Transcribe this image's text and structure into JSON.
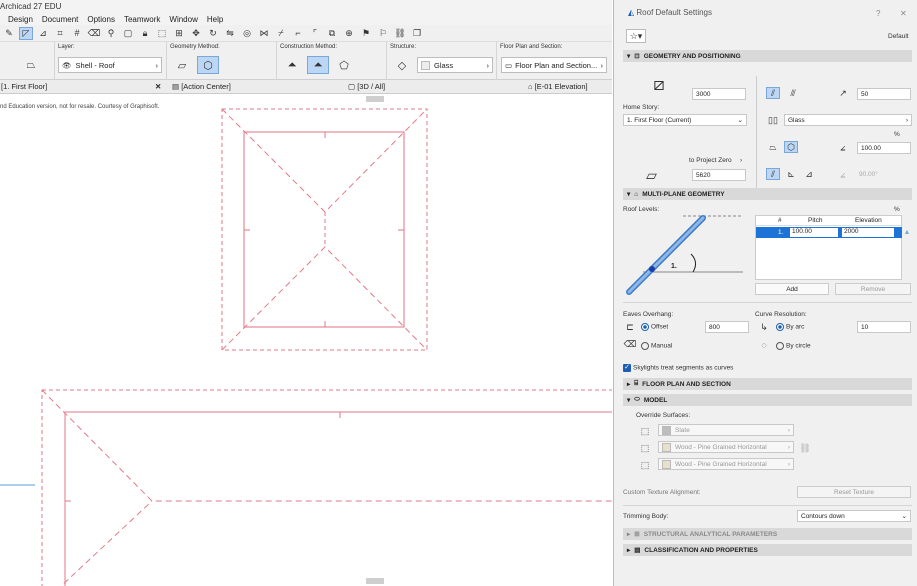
{
  "app": {
    "title": "Archicad 27 EDU",
    "menu": [
      "Design",
      "Document",
      "Options",
      "Teamwork",
      "Window",
      "Help"
    ]
  },
  "infobox": {
    "layer_label": "Layer:",
    "layer_value": "Shell - Roof",
    "geometry_label": "Geometry Method:",
    "construction_label": "Construction Method:",
    "structure_label": "Structure:",
    "structure_value": "Glass",
    "floorplan_label": "Floor Plan and Section:",
    "floorplan_value": "Floor Plan and Section..."
  },
  "tabs": [
    "[1. First Floor]",
    "[Action Center]",
    "[3D / All]",
    "[E-01 Elevation]"
  ],
  "canvas": {
    "watermark": "nd Education version, not for resale. Courtesy of Graphisoft."
  },
  "panel": {
    "title": "Roof Default Settings",
    "help": "?",
    "close": "✕",
    "favorites_default": "Default",
    "geometry": {
      "header": "GEOMETRY AND POSITIONING",
      "thickness": "3000",
      "pitch": "50",
      "home_story_label": "Home Story:",
      "home_story_value": "1. First Floor (Current)",
      "structure_value": "Glass",
      "percent": "%",
      "percent_value": "100.00",
      "to_project_zero_label": "to Project Zero",
      "project_zero_value": "5620",
      "angle_value": "90.00°"
    },
    "multiplane": {
      "header": "MULTI-PLANE GEOMETRY",
      "roof_levels_label": "Roof Levels:",
      "percent": "%",
      "col_num": "#",
      "col_pitch": "Pitch",
      "col_elev": "Elevation",
      "row_num": "1.",
      "row_pitch": "100.00",
      "row_elev": "2000",
      "diagram_label": "1.",
      "add_button": "Add",
      "remove_button": "Remove"
    },
    "eaves": {
      "label": "Eaves Overhang:",
      "offset_label": "Offset",
      "offset_value": "800",
      "manual_label": "Manual",
      "curve_label": "Curve Resolution:",
      "by_arc_label": "By arc",
      "by_arc_value": "10",
      "by_circle_label": "By circle"
    },
    "skylights_label": "Skylights treat segments as curves",
    "floorplan_header": "FLOOR PLAN AND SECTION",
    "model": {
      "header": "MODEL",
      "override_label": "Override Surfaces:",
      "surfaces": [
        "Slate",
        "Wood - Pine Grained Horizontal",
        "Wood - Pine Grained Horizontal"
      ]
    },
    "custom_texture_label": "Custom Texture Alignment:",
    "reset_texture_button": "Reset Texture",
    "trimming_label": "Trimming Body:",
    "trimming_value": "Contours down",
    "structural_header": "STRUCTURAL ANALYTICAL PARAMETERS",
    "classification_header": "CLASSIFICATION AND PROPERTIES"
  }
}
